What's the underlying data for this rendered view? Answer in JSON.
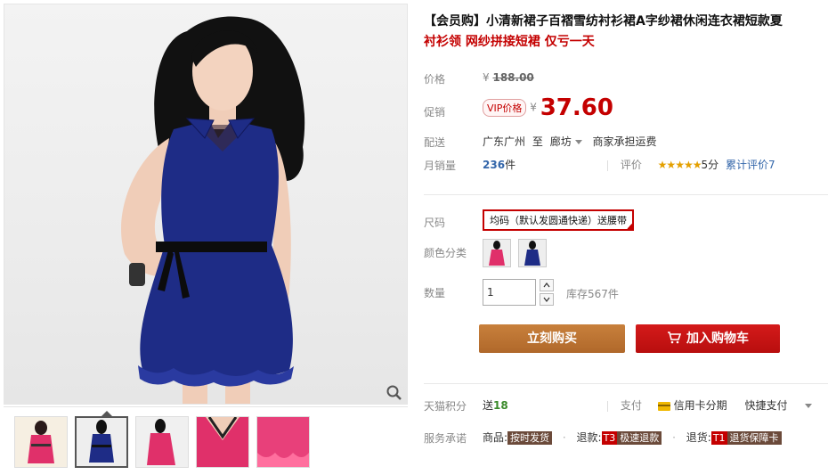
{
  "product": {
    "title": "【会员购】小清新裙子百褶雪纺衬衫裙A字纱裙休闲连衣裙短款夏",
    "subtitle": "衬衫领 网纱拼接短裙 仅亏一天"
  },
  "price": {
    "label": "价格",
    "currency": "¥",
    "original": "188.00"
  },
  "promo": {
    "label": "促销",
    "badge": "VIP价格",
    "currency": "¥",
    "value": "37.60"
  },
  "shipping": {
    "label": "配送",
    "from": "广东广州",
    "to_word": "至",
    "destination": "廊坊",
    "fee": "商家承担运费"
  },
  "sales": {
    "label": "月销量",
    "count": "236",
    "unit": "件",
    "review_label": "评价",
    "stars": "★★★★★",
    "rating": "5分",
    "review_count": "累计评价7"
  },
  "size": {
    "label": "尺码",
    "selected": "均码（默认发圆通快递）送腰带"
  },
  "color": {
    "label": "颜色分类",
    "swatches": [
      "pink",
      "navy"
    ]
  },
  "quantity": {
    "label": "数量",
    "value": "1",
    "stock": "库存567件"
  },
  "actions": {
    "buy_now": "立刻购买",
    "add_to_cart": "加入购物车"
  },
  "points": {
    "label": "天猫积分",
    "prefix": "送",
    "value": "18",
    "pay_label": "支付",
    "installment": "信用卡分期",
    "quick_pay": "快捷支付"
  },
  "service": {
    "label": "服务承诺",
    "goods_label": "商品:",
    "goods_tag": "按时发货",
    "refund_label": "退款:",
    "refund_code": "T3",
    "refund_tag": "极速退款",
    "return_label": "退货:",
    "return_code": "T1",
    "return_tag": "退货保障卡"
  },
  "gallery": {
    "thumbnails": [
      "pink-dress",
      "navy-dress",
      "pink-dress-side",
      "collar-detail",
      "hem-detail"
    ],
    "active_index": 1
  },
  "colors": {
    "accent_red": "#c40000",
    "buy_brown": "#b87030",
    "dress_navy": "#1e2c86",
    "dress_pink": "#e0306a"
  }
}
